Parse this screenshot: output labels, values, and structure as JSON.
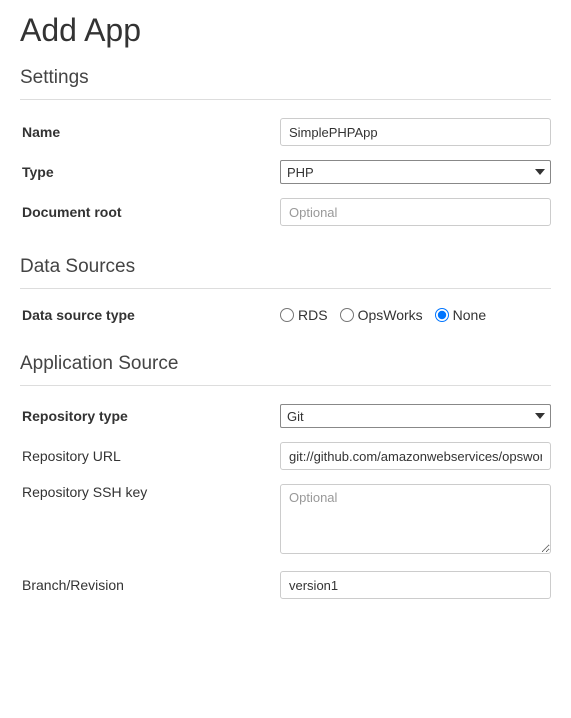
{
  "page": {
    "title": "Add App"
  },
  "sections": {
    "settings": {
      "title": "Settings",
      "name": {
        "label": "Name",
        "value": "SimplePHPApp"
      },
      "type": {
        "label": "Type",
        "value": "PHP"
      },
      "documentRoot": {
        "label": "Document root",
        "placeholder": "Optional",
        "value": ""
      }
    },
    "dataSources": {
      "title": "Data Sources",
      "dataSourceType": {
        "label": "Data source type",
        "options": {
          "rds": "RDS",
          "opsworks": "OpsWorks",
          "none": "None"
        },
        "selected": "none"
      }
    },
    "applicationSource": {
      "title": "Application Source",
      "repositoryType": {
        "label": "Repository type",
        "value": "Git"
      },
      "repositoryUrl": {
        "label": "Repository URL",
        "value": "git://github.com/amazonwebservices/opsworks"
      },
      "repositorySshKey": {
        "label": "Repository SSH key",
        "placeholder": "Optional",
        "value": ""
      },
      "branchRevision": {
        "label": "Branch/Revision",
        "value": "version1"
      }
    }
  }
}
